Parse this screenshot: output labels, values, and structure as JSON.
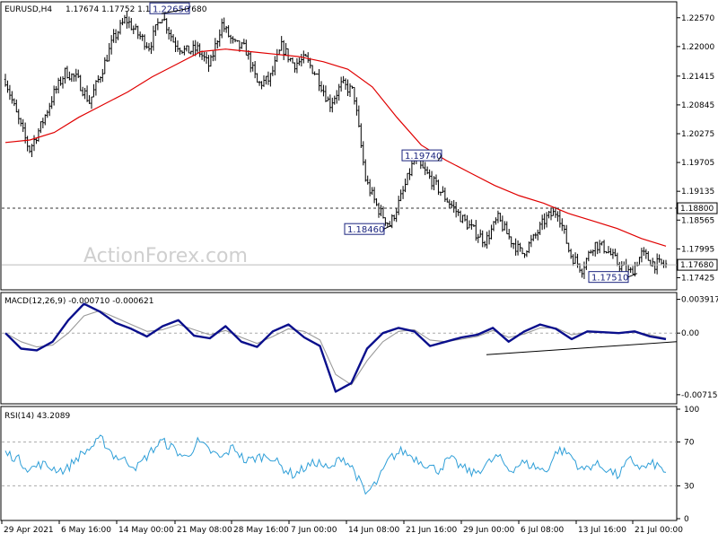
{
  "chart_data": [
    {
      "type": "candlestick",
      "title": "EURUSD,H4",
      "ohlc_text": "1.17674 1.17752 1.17674 1.17680",
      "watermark": "ActionForex.com",
      "y_ticks": [
        "1.22570",
        "1.22000",
        "1.21415",
        "1.20845",
        "1.20275",
        "1.19705",
        "1.19135",
        "1.18565",
        "1.17995",
        "1.17425"
      ],
      "ylim": [
        1.1722,
        1.2285
      ],
      "x_ticks": [
        "29 Apr 2021",
        "6 May 16:00",
        "14 May 00:00",
        "21 May 08:00",
        "28 May 16:00",
        "7 Jun 00:00",
        "14 Jun 08:00",
        "21 Jun 16:00",
        "29 Jun 00:00",
        "6 Jul 08:00",
        "13 Jul 16:00",
        "21 Jul 00:00"
      ],
      "horizontal_line": {
        "value": 1.188,
        "label": "1.18800",
        "style": "dashed"
      },
      "current_price": {
        "value": 1.1768,
        "label": "1.17680"
      },
      "price_path": [
        1.2135,
        1.206,
        1.1995,
        1.2045,
        1.2105,
        1.215,
        1.2135,
        1.209,
        1.215,
        1.2215,
        1.2255,
        1.2225,
        1.22,
        1.2265,
        1.221,
        1.219,
        1.2195,
        1.216,
        1.2245,
        1.2205,
        1.2195,
        1.2125,
        1.2135,
        1.22,
        1.2165,
        1.2175,
        1.214,
        1.2085,
        1.2125,
        1.211,
        1.1935,
        1.188,
        1.1846,
        1.1905,
        1.1974,
        1.195,
        1.192,
        1.189,
        1.186,
        1.1835,
        1.1815,
        1.186,
        1.182,
        1.179,
        1.182,
        1.186,
        1.1875,
        1.179,
        1.176,
        1.181,
        1.18,
        1.177,
        1.1751,
        1.179,
        1.177,
        1.1768
      ],
      "ma_path": [
        1.201,
        1.2015,
        1.203,
        1.206,
        1.2085,
        1.211,
        1.214,
        1.2165,
        1.219,
        1.2195,
        1.219,
        1.2185,
        1.218,
        1.217,
        1.2155,
        1.212,
        1.206,
        1.2005,
        1.1975,
        1.195,
        1.1925,
        1.1905,
        1.189,
        1.187,
        1.1855,
        1.184,
        1.182,
        1.1805
      ],
      "series": [
        {
          "name": "EURUSD,H4"
        }
      ],
      "annotations": [
        {
          "label": "1.22650",
          "value": 1.2265
        },
        {
          "label": "1.19740",
          "value": 1.1974
        },
        {
          "label": "1.18460",
          "value": 1.1846
        },
        {
          "label": "1.17510",
          "value": 1.1751
        }
      ]
    },
    {
      "type": "line",
      "title": "MACD(12,26,9) -0.000710 -0.000621",
      "y_ticks": [
        "0.003917",
        "0.00",
        "-0.007152"
      ],
      "ylim": [
        -0.008,
        0.0045
      ],
      "series": [
        {
          "name": "MACD",
          "color": "#0a0f8c",
          "values": [
            0.0,
            -0.0018,
            -0.002,
            -0.001,
            0.0015,
            0.0034,
            0.0025,
            0.0012,
            0.0005,
            -0.0004,
            0.0008,
            0.0015,
            -0.0003,
            -0.0006,
            0.0008,
            -0.001,
            -0.0016,
            0.0002,
            0.001,
            -0.0005,
            -0.0015,
            -0.0068,
            -0.0058,
            -0.0018,
            0.0,
            0.0006,
            0.0002,
            -0.0015,
            -0.001,
            -0.0005,
            -0.0002,
            0.0006,
            -0.001,
            0.0002,
            0.001,
            0.0005,
            -0.0007,
            0.0002,
            0.0001,
            0.0,
            0.0002,
            -0.0004,
            -0.0007
          ]
        },
        {
          "name": "Signal",
          "color": "#9a9a9a",
          "values": [
            0.0,
            -0.001,
            -0.0016,
            -0.0014,
            0.0,
            0.002,
            0.0026,
            0.0018,
            0.001,
            0.0002,
            0.0004,
            0.001,
            0.0004,
            -0.0002,
            0.0003,
            -0.0005,
            -0.0012,
            -0.0004,
            0.0005,
            0.0002,
            -0.0008,
            -0.0048,
            -0.006,
            -0.0032,
            -0.001,
            0.0002,
            0.0004,
            -0.0008,
            -0.001,
            -0.0007,
            -0.0004,
            0.0003,
            -0.0005,
            -0.0001,
            0.0006,
            0.0006,
            -0.0002,
            0.0001,
            0.0001,
            0.0,
            0.0001,
            -0.0002,
            -0.0006
          ]
        }
      ],
      "trendline": {
        "from": -0.0025,
        "to": -0.001
      }
    },
    {
      "type": "line",
      "title": "RSI(14) 43.2089",
      "y_ticks": [
        "100",
        "70",
        "30",
        "0"
      ],
      "ylim": [
        0,
        100
      ],
      "levels": [
        70,
        30
      ],
      "series": [
        {
          "name": "RSI",
          "color": "#2f9fd8",
          "values": [
            60,
            55,
            45,
            50,
            46,
            44,
            56,
            64,
            73,
            58,
            53,
            47,
            60,
            71,
            64,
            55,
            70,
            62,
            55,
            66,
            52,
            56,
            58,
            47,
            40,
            47,
            52,
            44,
            57,
            45,
            22,
            34,
            55,
            62,
            56,
            50,
            44,
            55,
            47,
            41,
            49,
            57,
            44,
            51,
            48,
            43,
            63,
            59,
            44,
            50,
            46,
            39,
            54,
            46,
            50,
            43
          ]
        }
      ]
    }
  ]
}
